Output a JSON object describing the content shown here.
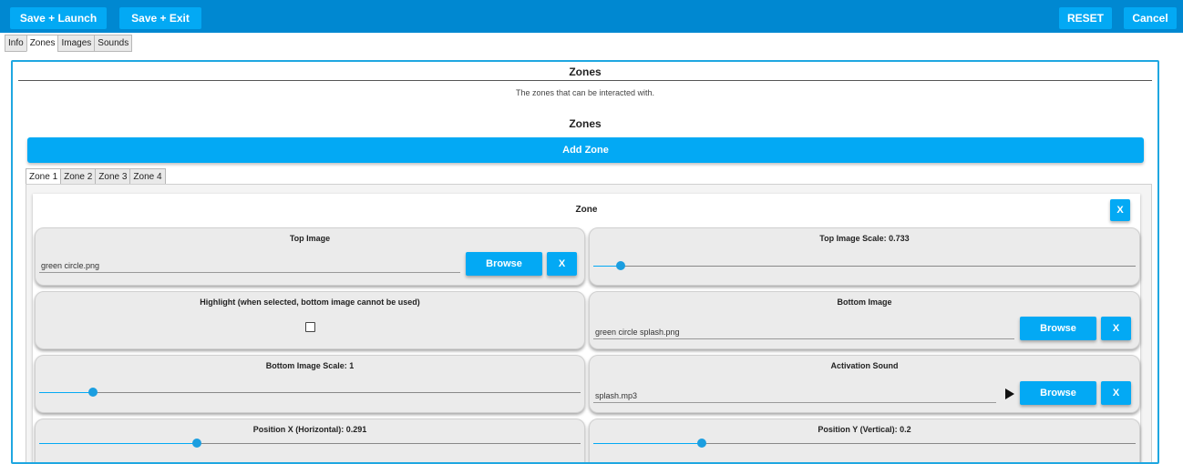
{
  "toolbar": {
    "save_launch": "Save + Launch",
    "save_exit": "Save + Exit",
    "reset": "RESET",
    "cancel": "Cancel"
  },
  "main_tabs": [
    "Info",
    "Zones",
    "Images",
    "Sounds"
  ],
  "active_main_tab": "Zones",
  "zones_panel": {
    "title": "Zones",
    "description": "The zones that can be interacted with.",
    "list_title": "Zones",
    "add_zone": "Add Zone"
  },
  "zone_tabs": [
    "Zone 1",
    "Zone 2",
    "Zone 3",
    "Zone 4"
  ],
  "active_zone_tab": "Zone 1",
  "zone": {
    "title": "Zone",
    "remove_label": "X",
    "top_image": {
      "label": "Top Image",
      "value": "green circle.png",
      "browse": "Browse",
      "clear": "X"
    },
    "top_image_scale": {
      "label": "Top Image Scale: 0.733",
      "level": 0.05
    },
    "highlight": {
      "label": "Highlight (when selected, bottom image cannot be used)",
      "checked": false
    },
    "bottom_image": {
      "label": "Bottom Image",
      "value": "green circle splash.png",
      "browse": "Browse",
      "clear": "X"
    },
    "bottom_image_scale": {
      "label": "Bottom Image Scale: 1",
      "level": 0.1
    },
    "activation_sound": {
      "label": "Activation Sound",
      "value": "splash.mp3",
      "browse": "Browse",
      "clear": "X"
    },
    "position_x": {
      "label": "Position X (Horizontal): 0.291",
      "level": 0.291
    },
    "position_y": {
      "label": "Position Y (Vertical): 0.2",
      "level": 0.2
    }
  },
  "colors": {
    "topbar": "#0088d1",
    "button": "#03a9f4",
    "panel_border": "#1fa7e1"
  }
}
